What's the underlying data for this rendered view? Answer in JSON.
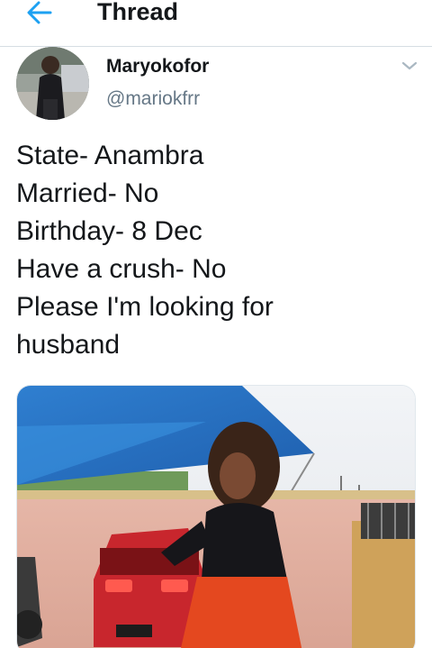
{
  "header": {
    "back_icon": "arrow-left-icon",
    "title": "Thread"
  },
  "tweet": {
    "author_name": "Maryokofor",
    "author_handle": "@mariokfrr",
    "menu_icon": "chevron-down-icon",
    "lines": [
      "State- Anambra",
      "Married- No",
      "Birthday- 8 Dec",
      "Have a crush- No",
      "Please I'm looking for",
      "husband"
    ]
  },
  "colors": {
    "accent": "#1da1f2",
    "text": "#14171a",
    "secondary_text": "#657786",
    "divider": "#d6dde3"
  }
}
